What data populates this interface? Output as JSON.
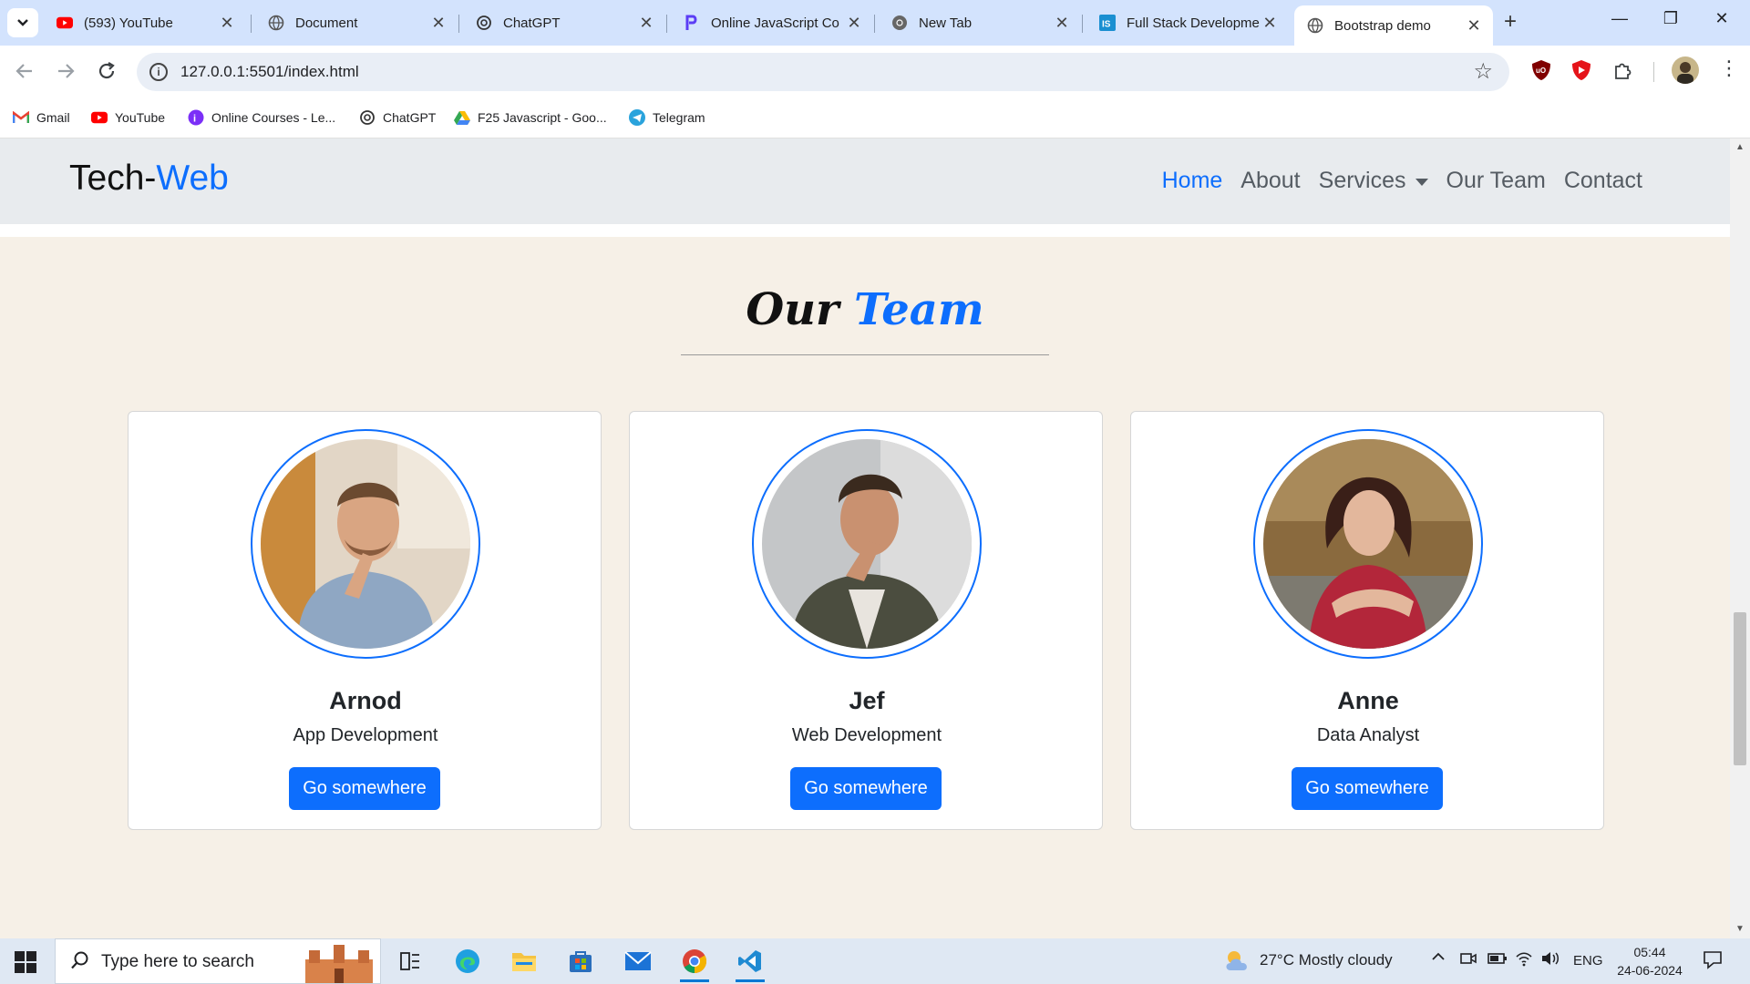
{
  "browser": {
    "tabs": [
      {
        "title": "(593) YouTube",
        "favicon": "youtube-icon",
        "active": false
      },
      {
        "title": "Document",
        "favicon": "globe-icon",
        "active": false
      },
      {
        "title": "ChatGPT",
        "favicon": "openai-icon",
        "active": false
      },
      {
        "title": "Online JavaScript Co",
        "favicon": "p-logo-icon",
        "active": false
      },
      {
        "title": "New Tab",
        "favicon": "chrome-icon",
        "active": false
      },
      {
        "title": "Full Stack Developme",
        "favicon": "is-logo-icon",
        "active": false
      },
      {
        "title": "Bootstrap demo",
        "favicon": "globe-icon",
        "active": true
      }
    ],
    "new_tab": "+",
    "close": "✕",
    "window_controls": {
      "minimize": "—",
      "restore": "❐",
      "close": "✕"
    },
    "address": "127.0.0.1:5501/index.html",
    "bookmarks": [
      {
        "label": "Gmail",
        "icon": "gmail-icon"
      },
      {
        "label": "YouTube",
        "icon": "youtube-icon"
      },
      {
        "label": "Online Courses - Le...",
        "icon": "courses-icon"
      },
      {
        "label": "ChatGPT",
        "icon": "openai-icon"
      },
      {
        "label": "F25 Javascript - Goo...",
        "icon": "google-drive-icon"
      },
      {
        "label": "Telegram",
        "icon": "telegram-icon"
      }
    ]
  },
  "site": {
    "brand": {
      "main": "Tech-",
      "accent": "Web"
    },
    "nav": [
      {
        "label": "Home",
        "active": true
      },
      {
        "label": "About",
        "active": false
      },
      {
        "label": "Services",
        "active": false,
        "dropdown": true
      },
      {
        "label": "Our Team",
        "active": false
      },
      {
        "label": "Contact",
        "active": false
      }
    ],
    "section": {
      "title_main": "Our",
      "title_accent": "Team"
    },
    "team": [
      {
        "name": "Arnod",
        "role": "App Development",
        "button": "Go somewhere"
      },
      {
        "name": "Jef",
        "role": "Web Development",
        "button": "Go somewhere"
      },
      {
        "name": "Anne",
        "role": "Data Analyst",
        "button": "Go somewhere"
      }
    ],
    "colors": {
      "accent": "#0d6efd",
      "background": "#f6f0e7",
      "navbar": "#e8ebee"
    }
  },
  "taskbar": {
    "search_placeholder": "Type here to search",
    "weather": "27°C  Mostly cloudy",
    "language": "ENG",
    "time": "05:44",
    "date": "24-06-2024",
    "pinned": [
      "task-view-icon",
      "edge-icon",
      "file-explorer-icon",
      "store-icon",
      "mail-icon",
      "chrome-icon",
      "vscode-icon"
    ]
  }
}
